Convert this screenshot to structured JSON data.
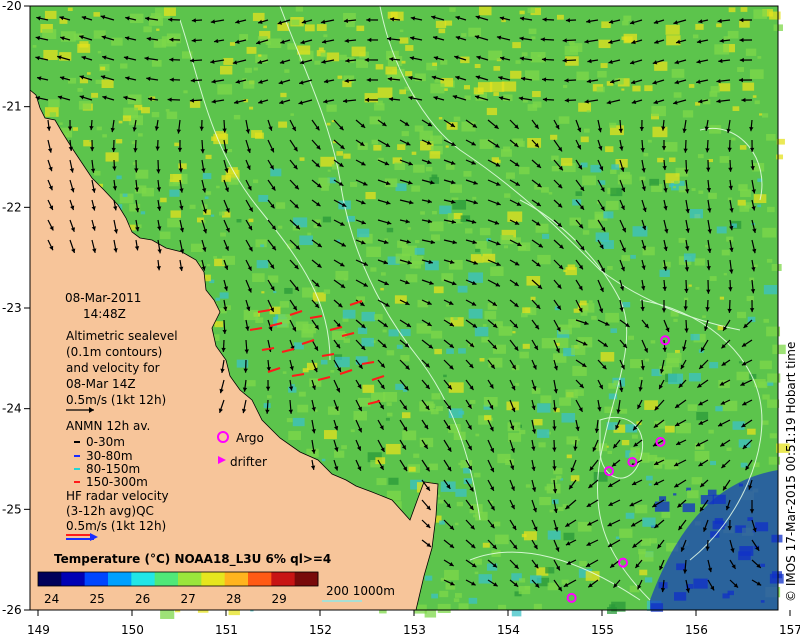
{
  "map": {
    "lat_ticks": [
      "-20",
      "-21",
      "-22",
      "-23",
      "-24",
      "-25",
      "-26"
    ],
    "lon_ticks": [
      "149",
      "150",
      "151",
      "152",
      "153",
      "154",
      "155",
      "156",
      "157"
    ],
    "colors": {
      "land": "#f7c59a",
      "ocean_green": "#5cc44c",
      "ocean_cyan": "#3bc2c6",
      "ocean_yellow": "#e4e21e",
      "ocean_blue": "#1030c8",
      "contour": "#e8ffe8",
      "vector": "#000000"
    }
  },
  "info": {
    "date": "08-Mar-2011",
    "time": "14:48Z",
    "altimetry": [
      "Altimetric sealevel",
      "(0.1m contours)",
      "and velocity for",
      "08-Mar 14Z",
      "0.5m/s (1kt 12h)"
    ],
    "anmn_title": "ANMN 12h av.",
    "anmn_items": [
      {
        "label": "0-30m",
        "color": "#000000"
      },
      {
        "label": "30-80m",
        "color": "#1a2cff"
      },
      {
        "label": "80-150m",
        "color": "#22d4d4"
      },
      {
        "label": "150-300m",
        "color": "#ff1a1a"
      }
    ],
    "argo": "Argo",
    "drifter": "drifter",
    "argo_color": "#ff00ff",
    "hf": [
      "HF radar velocity",
      "(3-12h avg)QC",
      "0.5m/s (1kt 12h)"
    ]
  },
  "colorbar": {
    "title": "Temperature (°C) NOAA18_L3U 6% ql>=4",
    "ticks": [
      "24",
      "25",
      "26",
      "27",
      "28",
      "29"
    ],
    "scale": [
      "#00005a",
      "#0000b4",
      "#0046ff",
      "#00a0ff",
      "#22e6e6",
      "#50e878",
      "#9ae63c",
      "#e6e61e",
      "#ffb41e",
      "#ff5a14",
      "#c81414",
      "#780a0a"
    ]
  },
  "depth_legend": "200  1000m",
  "credit": "© IMOS 17-Mar-2015 00:51:19 Hobart time",
  "argo_floats": [
    {
      "lon": 155.75,
      "lat": -23.32
    },
    {
      "lon": 155.7,
      "lat": -24.33
    },
    {
      "lon": 155.4,
      "lat": -24.53
    },
    {
      "lon": 155.15,
      "lat": -24.62
    },
    {
      "lon": 155.3,
      "lat": -25.53
    },
    {
      "lon": 154.75,
      "lat": -25.88
    }
  ]
}
